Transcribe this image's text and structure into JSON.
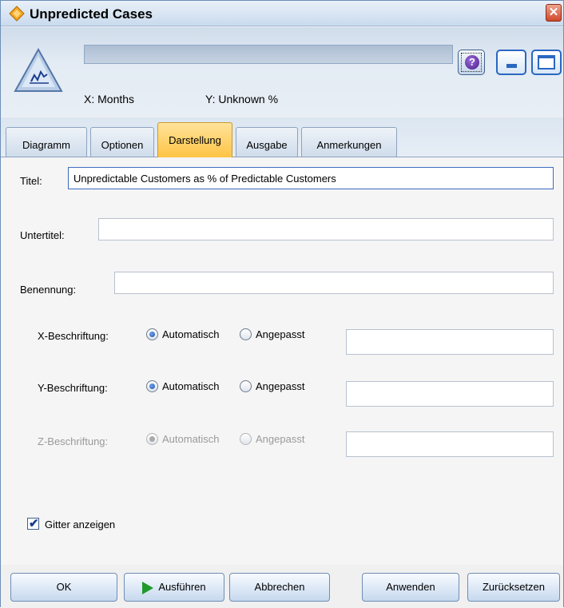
{
  "window": {
    "title": "Unpredicted Cases",
    "close_glyph": "✕"
  },
  "header": {
    "axis_x": "X: Months",
    "axis_y": "Y: Unknown %",
    "help_glyph": "?"
  },
  "tabs": [
    {
      "label": "Diagramm",
      "active": false
    },
    {
      "label": "Optionen",
      "active": false
    },
    {
      "label": "Darstellung",
      "active": true
    },
    {
      "label": "Ausgabe",
      "active": false
    },
    {
      "label": "Anmerkungen",
      "active": false
    }
  ],
  "form": {
    "title_label": "Titel:",
    "title_value": "Unpredictable Customers as % of Predictable Customers",
    "subtitle_label": "Untertitel:",
    "subtitle_value": "",
    "caption_label": "Benennung:",
    "caption_value": "",
    "x_label": "X-Beschriftung:",
    "y_label": "Y-Beschriftung:",
    "z_label": "Z-Beschriftung:",
    "auto_label": "Automatisch",
    "custom_label": "Angepasst",
    "x_mode": "Automatisch",
    "y_mode": "Automatisch",
    "z_mode": "Automatisch",
    "z_enabled": false,
    "grid_label": "Gitter anzeigen",
    "grid_checked": true
  },
  "footer": {
    "ok": "OK",
    "run": "Ausführen",
    "cancel": "Abbrechen",
    "apply": "Anwenden",
    "reset": "Zurücksetzen"
  },
  "colors": {
    "active_tab": "#ffc446",
    "focus_border": "#3d6cbf",
    "run_icon": "#1f9a2b"
  }
}
